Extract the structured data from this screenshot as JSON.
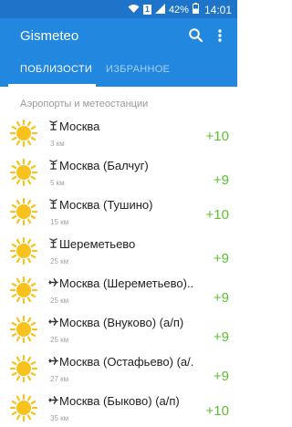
{
  "status_bar": {
    "sim_label": "1",
    "battery": "42%",
    "time": "14:01"
  },
  "app": {
    "title": "Gismeteo",
    "tabs": [
      {
        "label": "ПОБЛИЗОСТИ",
        "active": true
      },
      {
        "label": "ИЗБРАННОЕ",
        "active": false
      }
    ],
    "section_header": "Аэропорты и метеостанции"
  },
  "stations": [
    {
      "prefix": "tower",
      "name": "Москва",
      "distance": "3 км",
      "temp": "+10",
      "icon": "sun-icon"
    },
    {
      "prefix": "tower",
      "name": "Москва (Балчуг)",
      "distance": "5 км",
      "temp": "+9",
      "icon": "sun-icon"
    },
    {
      "prefix": "tower",
      "name": "Москва (Тушино)",
      "distance": "15 км",
      "temp": "+10",
      "icon": "sun-icon"
    },
    {
      "prefix": "tower",
      "name": "Шереметьево",
      "distance": "25 км",
      "temp": "+9",
      "icon": "sun-icon"
    },
    {
      "prefix": "plane",
      "name": "Москва (Шереметьево)...",
      "distance": "25 км",
      "temp": "+9",
      "icon": "sun-icon"
    },
    {
      "prefix": "plane",
      "name": "Москва (Внуково) (а/п)",
      "distance": "25 км",
      "temp": "+9",
      "icon": "sun-icon"
    },
    {
      "prefix": "plane",
      "name": "Москва (Остафьево) (а/...",
      "distance": "27 км",
      "temp": "+9",
      "icon": "sun-icon"
    },
    {
      "prefix": "plane",
      "name": "Москва (Быково) (а/п)",
      "distance": "35 км",
      "temp": "+10",
      "icon": "sun-icon"
    }
  ],
  "colors": {
    "status_bar": "#1e74c8",
    "app_bar": "#2287df",
    "temp": "#5cc033",
    "sun": "#f7c21e"
  }
}
